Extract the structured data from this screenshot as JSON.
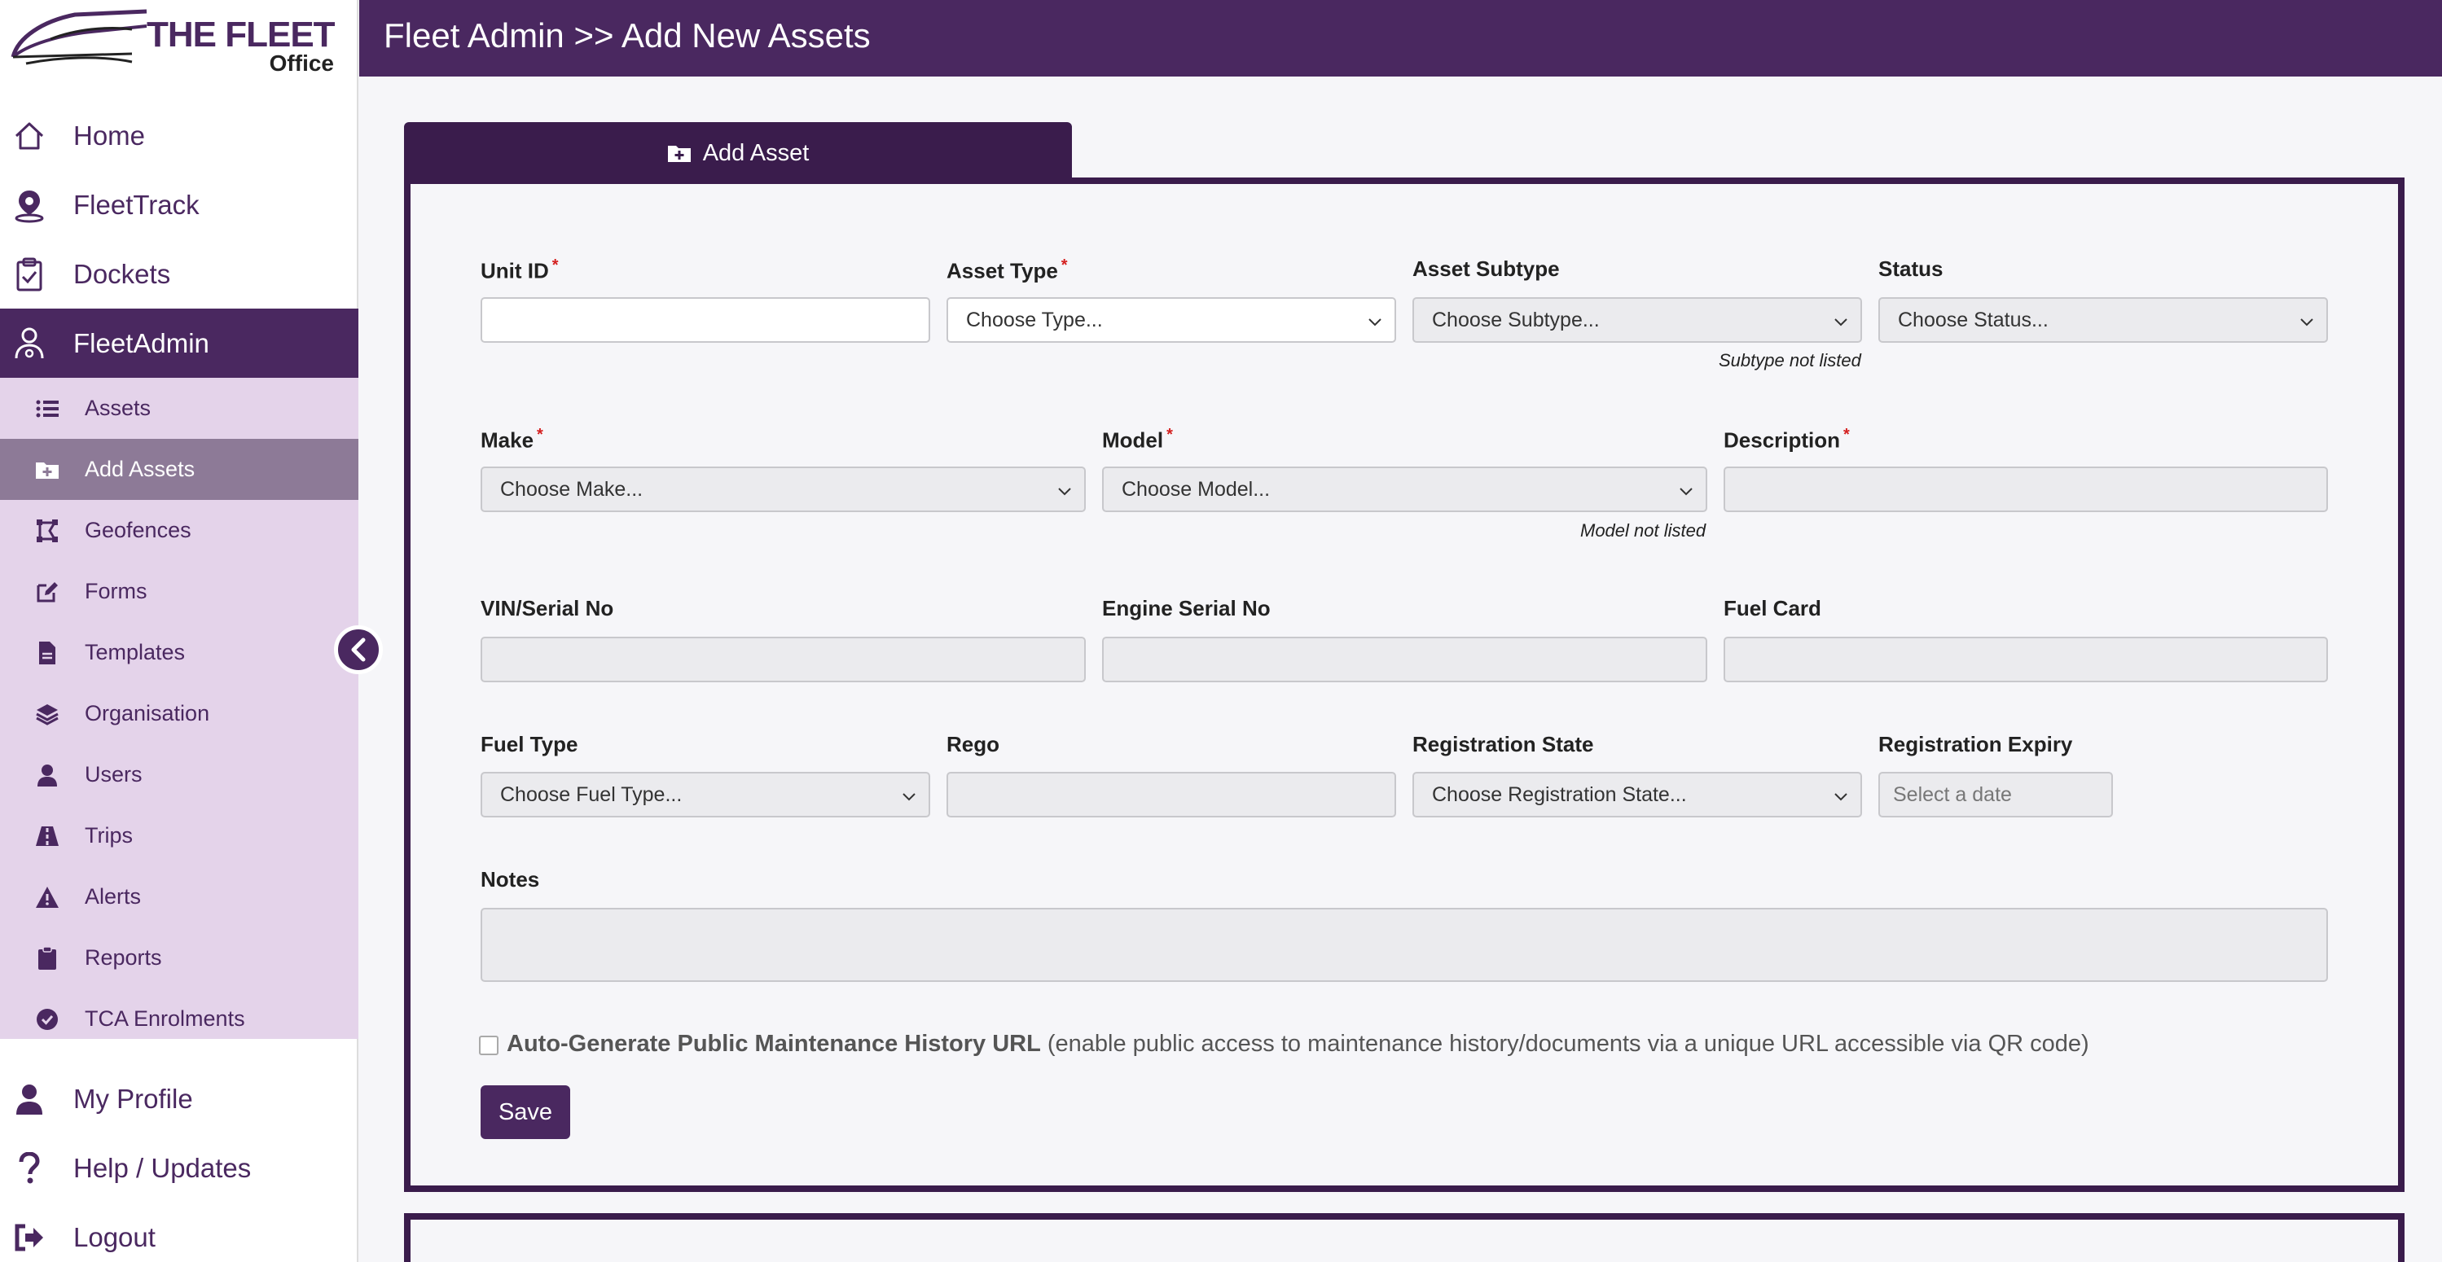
{
  "logo": {
    "title": "THE FLEET",
    "subtitle": "Office"
  },
  "header": {
    "title": "Fleet Admin >> Add New Assets"
  },
  "nav": {
    "home": "Home",
    "fleettrack": "FleetTrack",
    "dockets": "Dockets",
    "fleetadmin": "FleetAdmin",
    "my_profile": "My Profile",
    "help": "Help / Updates",
    "logout": "Logout"
  },
  "subnav": {
    "assets": "Assets",
    "add_assets": "Add Assets",
    "geofences": "Geofences",
    "forms": "Forms",
    "templates": "Templates",
    "organisation": "Organisation",
    "users": "Users",
    "trips": "Trips",
    "alerts": "Alerts",
    "reports": "Reports",
    "tca": "TCA Enrolments"
  },
  "tab": {
    "label": "Add Asset"
  },
  "form": {
    "unit_id": {
      "label": "Unit ID",
      "value": ""
    },
    "asset_type": {
      "label": "Asset Type",
      "value": "Choose Type..."
    },
    "asset_subtype": {
      "label": "Asset Subtype",
      "value": "Choose Subtype...",
      "hint": "Subtype not listed"
    },
    "status": {
      "label": "Status",
      "value": "Choose Status..."
    },
    "make": {
      "label": "Make",
      "value": "Choose Make..."
    },
    "model": {
      "label": "Model",
      "value": "Choose Model...",
      "hint": "Model not listed"
    },
    "description": {
      "label": "Description",
      "value": ""
    },
    "vin": {
      "label": "VIN/Serial No",
      "value": ""
    },
    "engine_serial": {
      "label": "Engine Serial No",
      "value": ""
    },
    "fuel_card": {
      "label": "Fuel Card",
      "value": ""
    },
    "fuel_type": {
      "label": "Fuel Type",
      "value": "Choose Fuel Type..."
    },
    "rego": {
      "label": "Rego",
      "value": ""
    },
    "reg_state": {
      "label": "Registration State",
      "value": "Choose Registration State..."
    },
    "reg_expiry": {
      "label": "Registration Expiry",
      "placeholder": "Select a date"
    },
    "notes": {
      "label": "Notes",
      "value": ""
    },
    "auto_generate": {
      "bold": "Auto-Generate Public Maintenance History URL",
      "rest": " (enable public access to maintenance history/documents via a unique URL accessible via QR code)",
      "checked": false
    },
    "save_label": "Save"
  },
  "colors": {
    "brand": "#4a2860",
    "brand_dark": "#3a1c4c",
    "subnav_bg": "#e4d3ea",
    "subnav_active": "#8d7a97",
    "required": "#d42020"
  },
  "icons": {
    "home": "home-icon",
    "fleettrack": "map-pin-icon",
    "dockets": "clipboard-check-icon",
    "fleetadmin": "user-gear-icon",
    "assets": "list-icon",
    "add_assets": "folder-plus-icon",
    "geofences": "geofence-icon",
    "forms": "edit-icon",
    "templates": "file-icon",
    "organisation": "layers-icon",
    "users": "user-icon",
    "trips": "road-icon",
    "alerts": "warning-icon",
    "reports": "clipboard-icon",
    "tca": "check-circle-icon",
    "my_profile": "user-icon",
    "help": "question-icon",
    "logout": "sign-out-icon",
    "collapse": "chevron-left-icon"
  }
}
